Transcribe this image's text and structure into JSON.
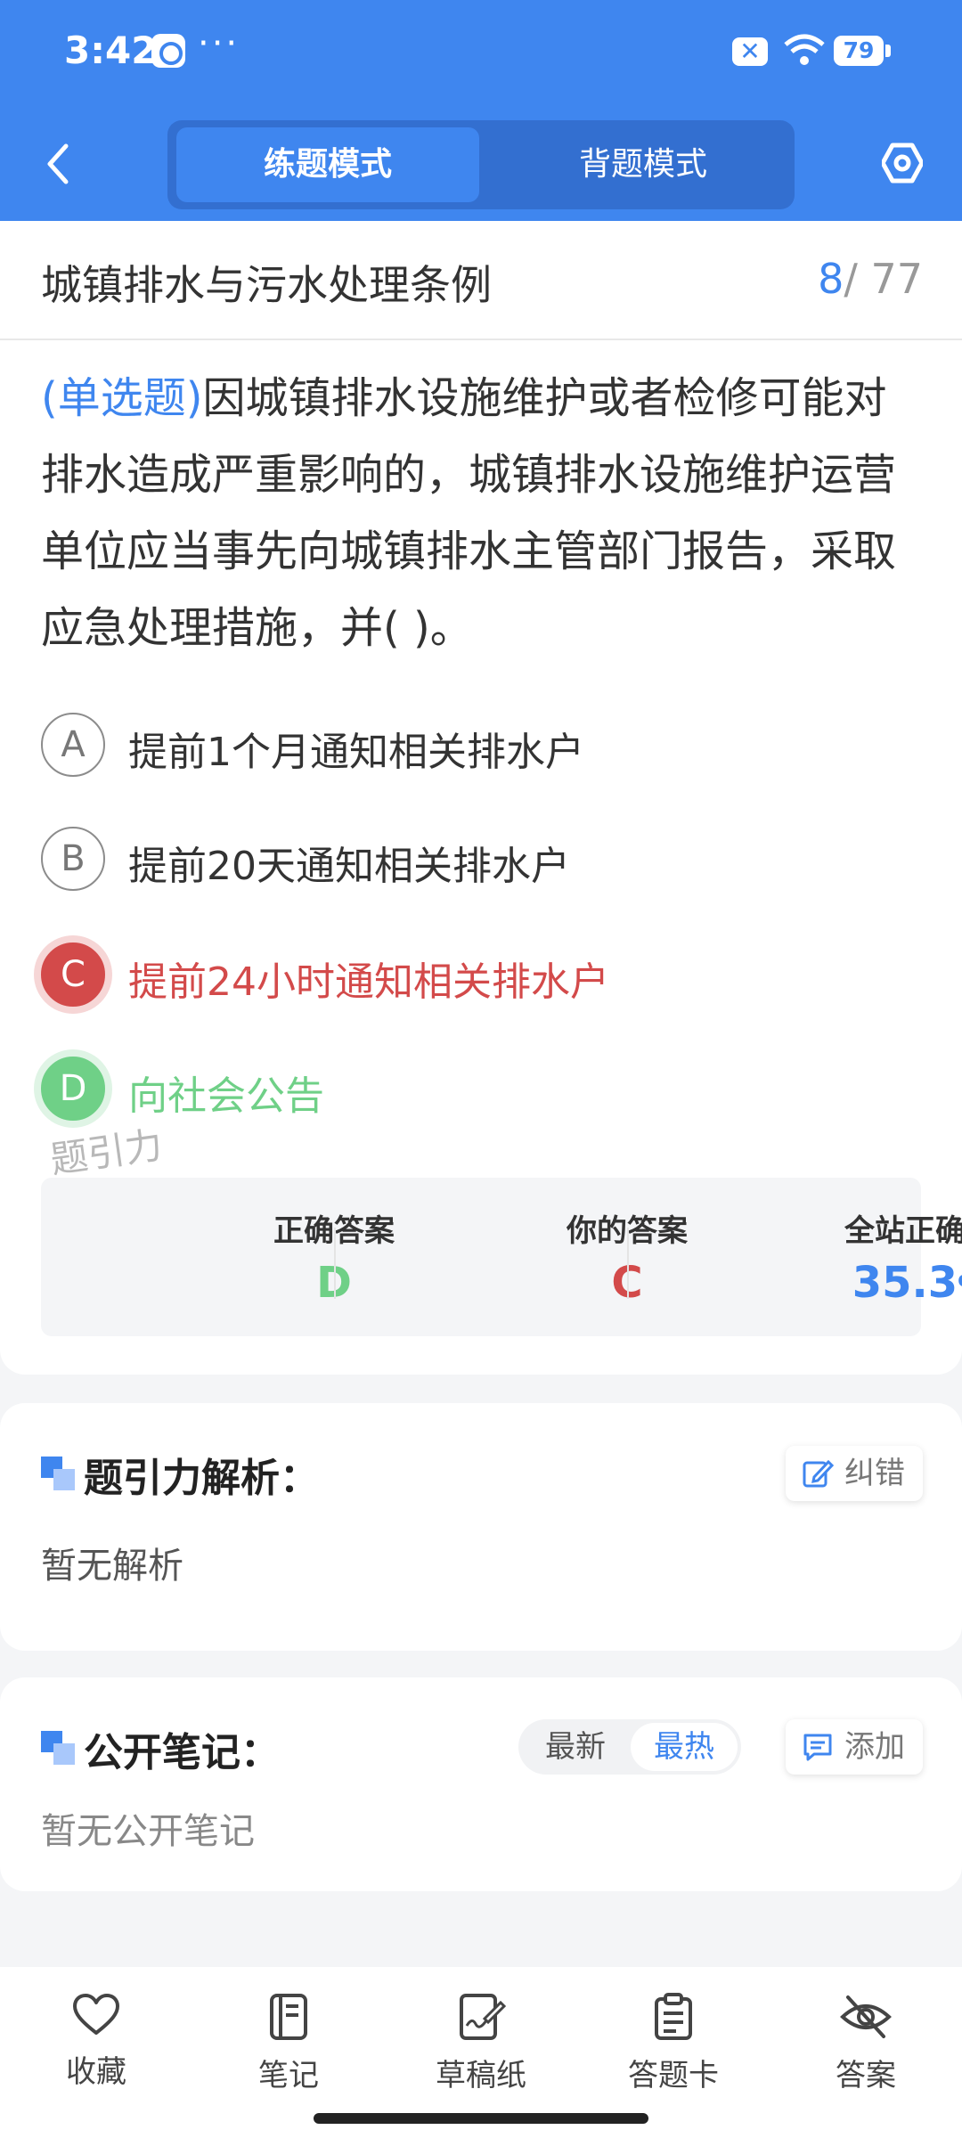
{
  "status": {
    "time": "3:42",
    "dots": "···",
    "battery": "79",
    "notif_mark": "✕"
  },
  "header": {
    "tabs": [
      "练题模式",
      "背题模式"
    ],
    "active_tab": 0
  },
  "question": {
    "chapter": "城镇排水与污水处理条例",
    "current": "8",
    "total": "/ 77",
    "type_label": "(单选题)",
    "text": "因城镇排水设施维护或者检修可能对排水造成严重影响的，城镇排水设施维护运营单位应当事先向城镇排水主管部门报告，采取应急处理措施，并(        )。",
    "options": [
      {
        "letter": "A",
        "text": "提前1个月通知相关排水户",
        "state": "normal"
      },
      {
        "letter": "B",
        "text": "提前20天通知相关排水户",
        "state": "normal"
      },
      {
        "letter": "C",
        "text": "提前24小时通知相关排水户",
        "state": "wrong"
      },
      {
        "letter": "D",
        "text": "向社会公告",
        "state": "right"
      }
    ],
    "watermark": "题引力"
  },
  "stats": {
    "correct_label": "正确答案",
    "correct_value": "D",
    "yours_label": "你的答案",
    "yours_value": "C",
    "rate_label": "全站正确率",
    "rate_value": "35.3",
    "rate_unit": "%"
  },
  "colors": {
    "primary": "#3f86ef",
    "wrong": "#d34a4a",
    "right": "#6fd087"
  },
  "analysis": {
    "title": "题引力解析：",
    "button": "纠错",
    "body": "暂无解析"
  },
  "notes": {
    "title": "公开笔记：",
    "sort": [
      "最新",
      "最热"
    ],
    "active_sort": 1,
    "button": "添加",
    "body": "暂无公开笔记"
  },
  "tabbar": [
    {
      "label": "收藏",
      "icon": "heart-icon"
    },
    {
      "label": "笔记",
      "icon": "notebook-icon"
    },
    {
      "label": "草稿纸",
      "icon": "draft-paper-icon"
    },
    {
      "label": "答题卡",
      "icon": "answer-sheet-icon"
    },
    {
      "label": "答案",
      "icon": "eye-off-icon"
    }
  ]
}
